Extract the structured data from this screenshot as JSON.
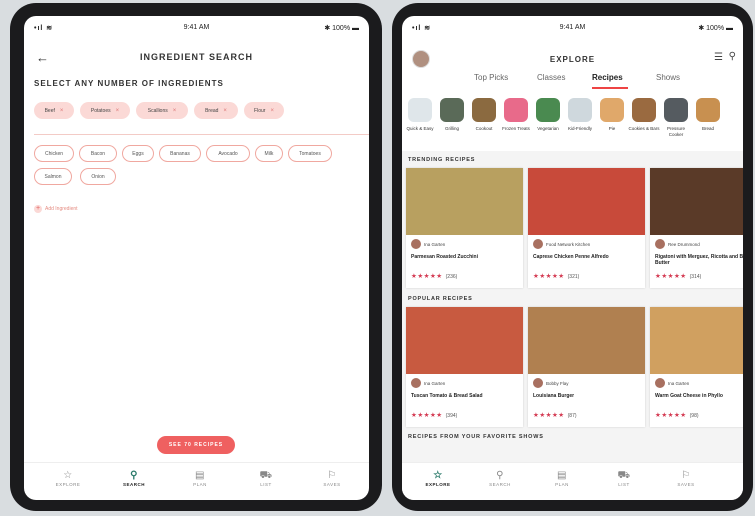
{
  "left": {
    "status": {
      "time": "9:41 AM",
      "battery": "100%"
    },
    "title": "INGREDIENT SEARCH",
    "select_label": "SELECT ANY NUMBER OF INGREDIENTS",
    "selected": [
      "Beef",
      "Potatoes",
      "Scallions",
      "Bread",
      "Flour"
    ],
    "options": [
      "Chicken",
      "Bacon",
      "Eggs",
      "Bananas",
      "Avocado",
      "Milk",
      "Tomatoes",
      "Salmon",
      "Onion"
    ],
    "add_label": "Add Ingredient",
    "see_button": "SEE 70 RECIPES",
    "tabs": [
      "EXPLORE",
      "SEARCH",
      "PLAN",
      "LIST",
      "SAVES"
    ],
    "active_tab": "SEARCH"
  },
  "right": {
    "status": {
      "time": "9:41 AM",
      "battery": "100%"
    },
    "title": "EXPLORE",
    "top_tabs": [
      "Top Picks",
      "Classes",
      "Recipes",
      "Shows"
    ],
    "active_top_tab": "Recipes",
    "categories": [
      {
        "label": "Quick & Easy",
        "color": "#dfe6ea"
      },
      {
        "label": "Grilling",
        "color": "#5a6a58"
      },
      {
        "label": "Cookout",
        "color": "#8b6a40"
      },
      {
        "label": "Frozen Treats",
        "color": "#e86a8a"
      },
      {
        "label": "Vegetarian",
        "color": "#4a8a50"
      },
      {
        "label": "Kid-Friendly",
        "color": "#cfd8dd"
      },
      {
        "label": "Pie",
        "color": "#e0a86a"
      },
      {
        "label": "Cookies & Bars",
        "color": "#9a6a40"
      },
      {
        "label": "Pressure Cooker",
        "color": "#555b60"
      },
      {
        "label": "Bread",
        "color": "#c89050"
      }
    ],
    "sections": {
      "trending": "TRENDING RECIPES",
      "popular": "POPULAR RECIPES",
      "shows": "RECIPES FROM YOUR FAVORITE SHOWS"
    },
    "trending": [
      {
        "chef": "Ina Garten",
        "name": "Parmesan Roasted Zucchini",
        "stars": "★★★★★",
        "count": "(236)",
        "img": "#b8a060"
      },
      {
        "chef": "Food Network Kitchen",
        "name": "Caprese Chicken Penne Alfredo",
        "stars": "★★★★★",
        "count": "(321)",
        "img": "#c84a3a"
      },
      {
        "chef": "Ree Drummond",
        "name": "Rigatoni with Merguez, Ricotta and Brown Butter",
        "stars": "★★★★★",
        "count": "(314)",
        "img": "#5a3a28"
      }
    ],
    "popular": [
      {
        "chef": "Ina Garten",
        "name": "Tuscan Tomato & Bread Salad",
        "stars": "★★★★★",
        "count": "(394)",
        "img": "#c85a40"
      },
      {
        "chef": "Bobby Flay",
        "name": "Louisiana Burger",
        "stars": "★★★★★",
        "count": "(87)",
        "img": "#b08050"
      },
      {
        "chef": "Ina Garten",
        "name": "Warm Goat Cheese in Phyllo",
        "stars": "★★★★★",
        "count": "(98)",
        "img": "#d0a060"
      }
    ],
    "tabs": [
      "EXPLORE",
      "SEARCH",
      "PLAN",
      "LIST",
      "SAVES"
    ],
    "active_tab": "EXPLORE"
  }
}
